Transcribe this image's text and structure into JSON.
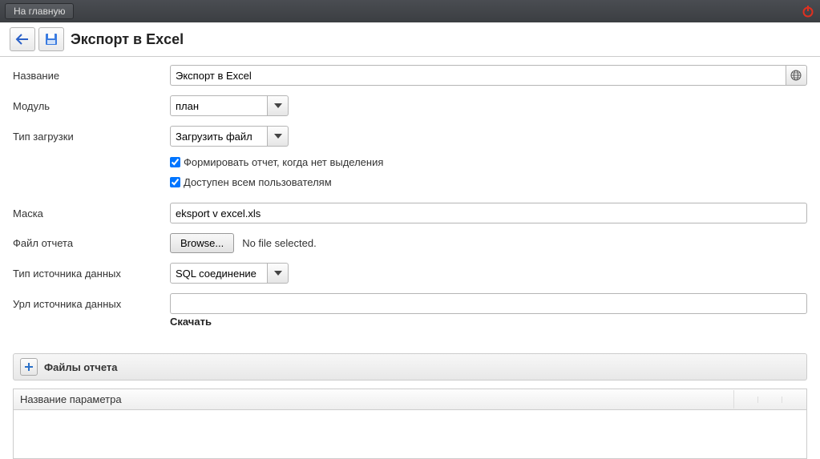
{
  "topbar": {
    "home_label": "На главную"
  },
  "toolbar": {
    "page_title": "Экспорт в Excel"
  },
  "form": {
    "name_label": "Название",
    "name_value": "Экспорт в Excel",
    "module_label": "Модуль",
    "module_value": "план",
    "load_type_label": "Тип загрузки",
    "load_type_value": "Загрузить файл",
    "checkbox1_label": "Формировать отчет, когда нет выделения",
    "checkbox2_label": "Доступен всем пользователям",
    "mask_label": "Маска",
    "mask_value": "eksport v excel.xls",
    "report_file_label": "Файл отчета",
    "browse_label": "Browse...",
    "no_file_label": "No file selected.",
    "source_type_label": "Тип источника данных",
    "source_type_value": "SQL соединение",
    "source_url_label": "Урл источника данных",
    "source_url_value": "",
    "download_label": "Скачать"
  },
  "section": {
    "title": "Файлы отчета"
  },
  "grid": {
    "col1": "Название параметра"
  }
}
